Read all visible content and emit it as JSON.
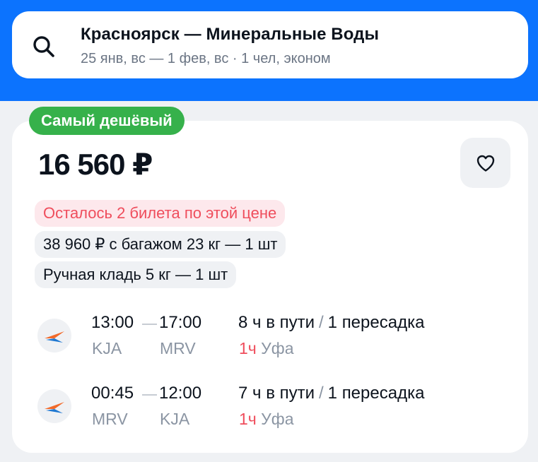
{
  "search": {
    "route": "Красноярск — Минеральные Воды",
    "details": "25 янв, вс — 1 фев, вс · 1 чел, эконом"
  },
  "ticket": {
    "badge": "Самый дешёвый",
    "price": "16 560 ₽",
    "tickets_left": "Осталось 2 билета по этой цене",
    "baggage_offer": "38 960 ₽ с багажом 23 кг — 1 шт",
    "hand_luggage": "Ручная кладь 5 кг — 1 шт",
    "segments": [
      {
        "dep_time": "13:00",
        "arr_time": "17:00",
        "dep_airport": "KJA",
        "arr_airport": "MRV",
        "duration": "8 ч в пути",
        "slash": "/",
        "stops": "1 пересадка",
        "layover_time": "1ч",
        "layover_city": "Уфа"
      },
      {
        "dep_time": "00:45",
        "arr_time": "12:00",
        "dep_airport": "MRV",
        "arr_airport": "KJA",
        "duration": "7 ч в пути",
        "slash": "/",
        "stops": "1 пересадка",
        "layover_time": "1ч",
        "layover_city": "Уфа"
      }
    ]
  },
  "icons": {
    "search": "search-icon",
    "favorite": "heart-icon",
    "airline": "airline-logo-icon"
  },
  "colors": {
    "header_blue": "#0c73fe",
    "badge_green": "#36b14b",
    "warning_red": "#ef4d5c",
    "muted_gray": "#8b95a3"
  }
}
